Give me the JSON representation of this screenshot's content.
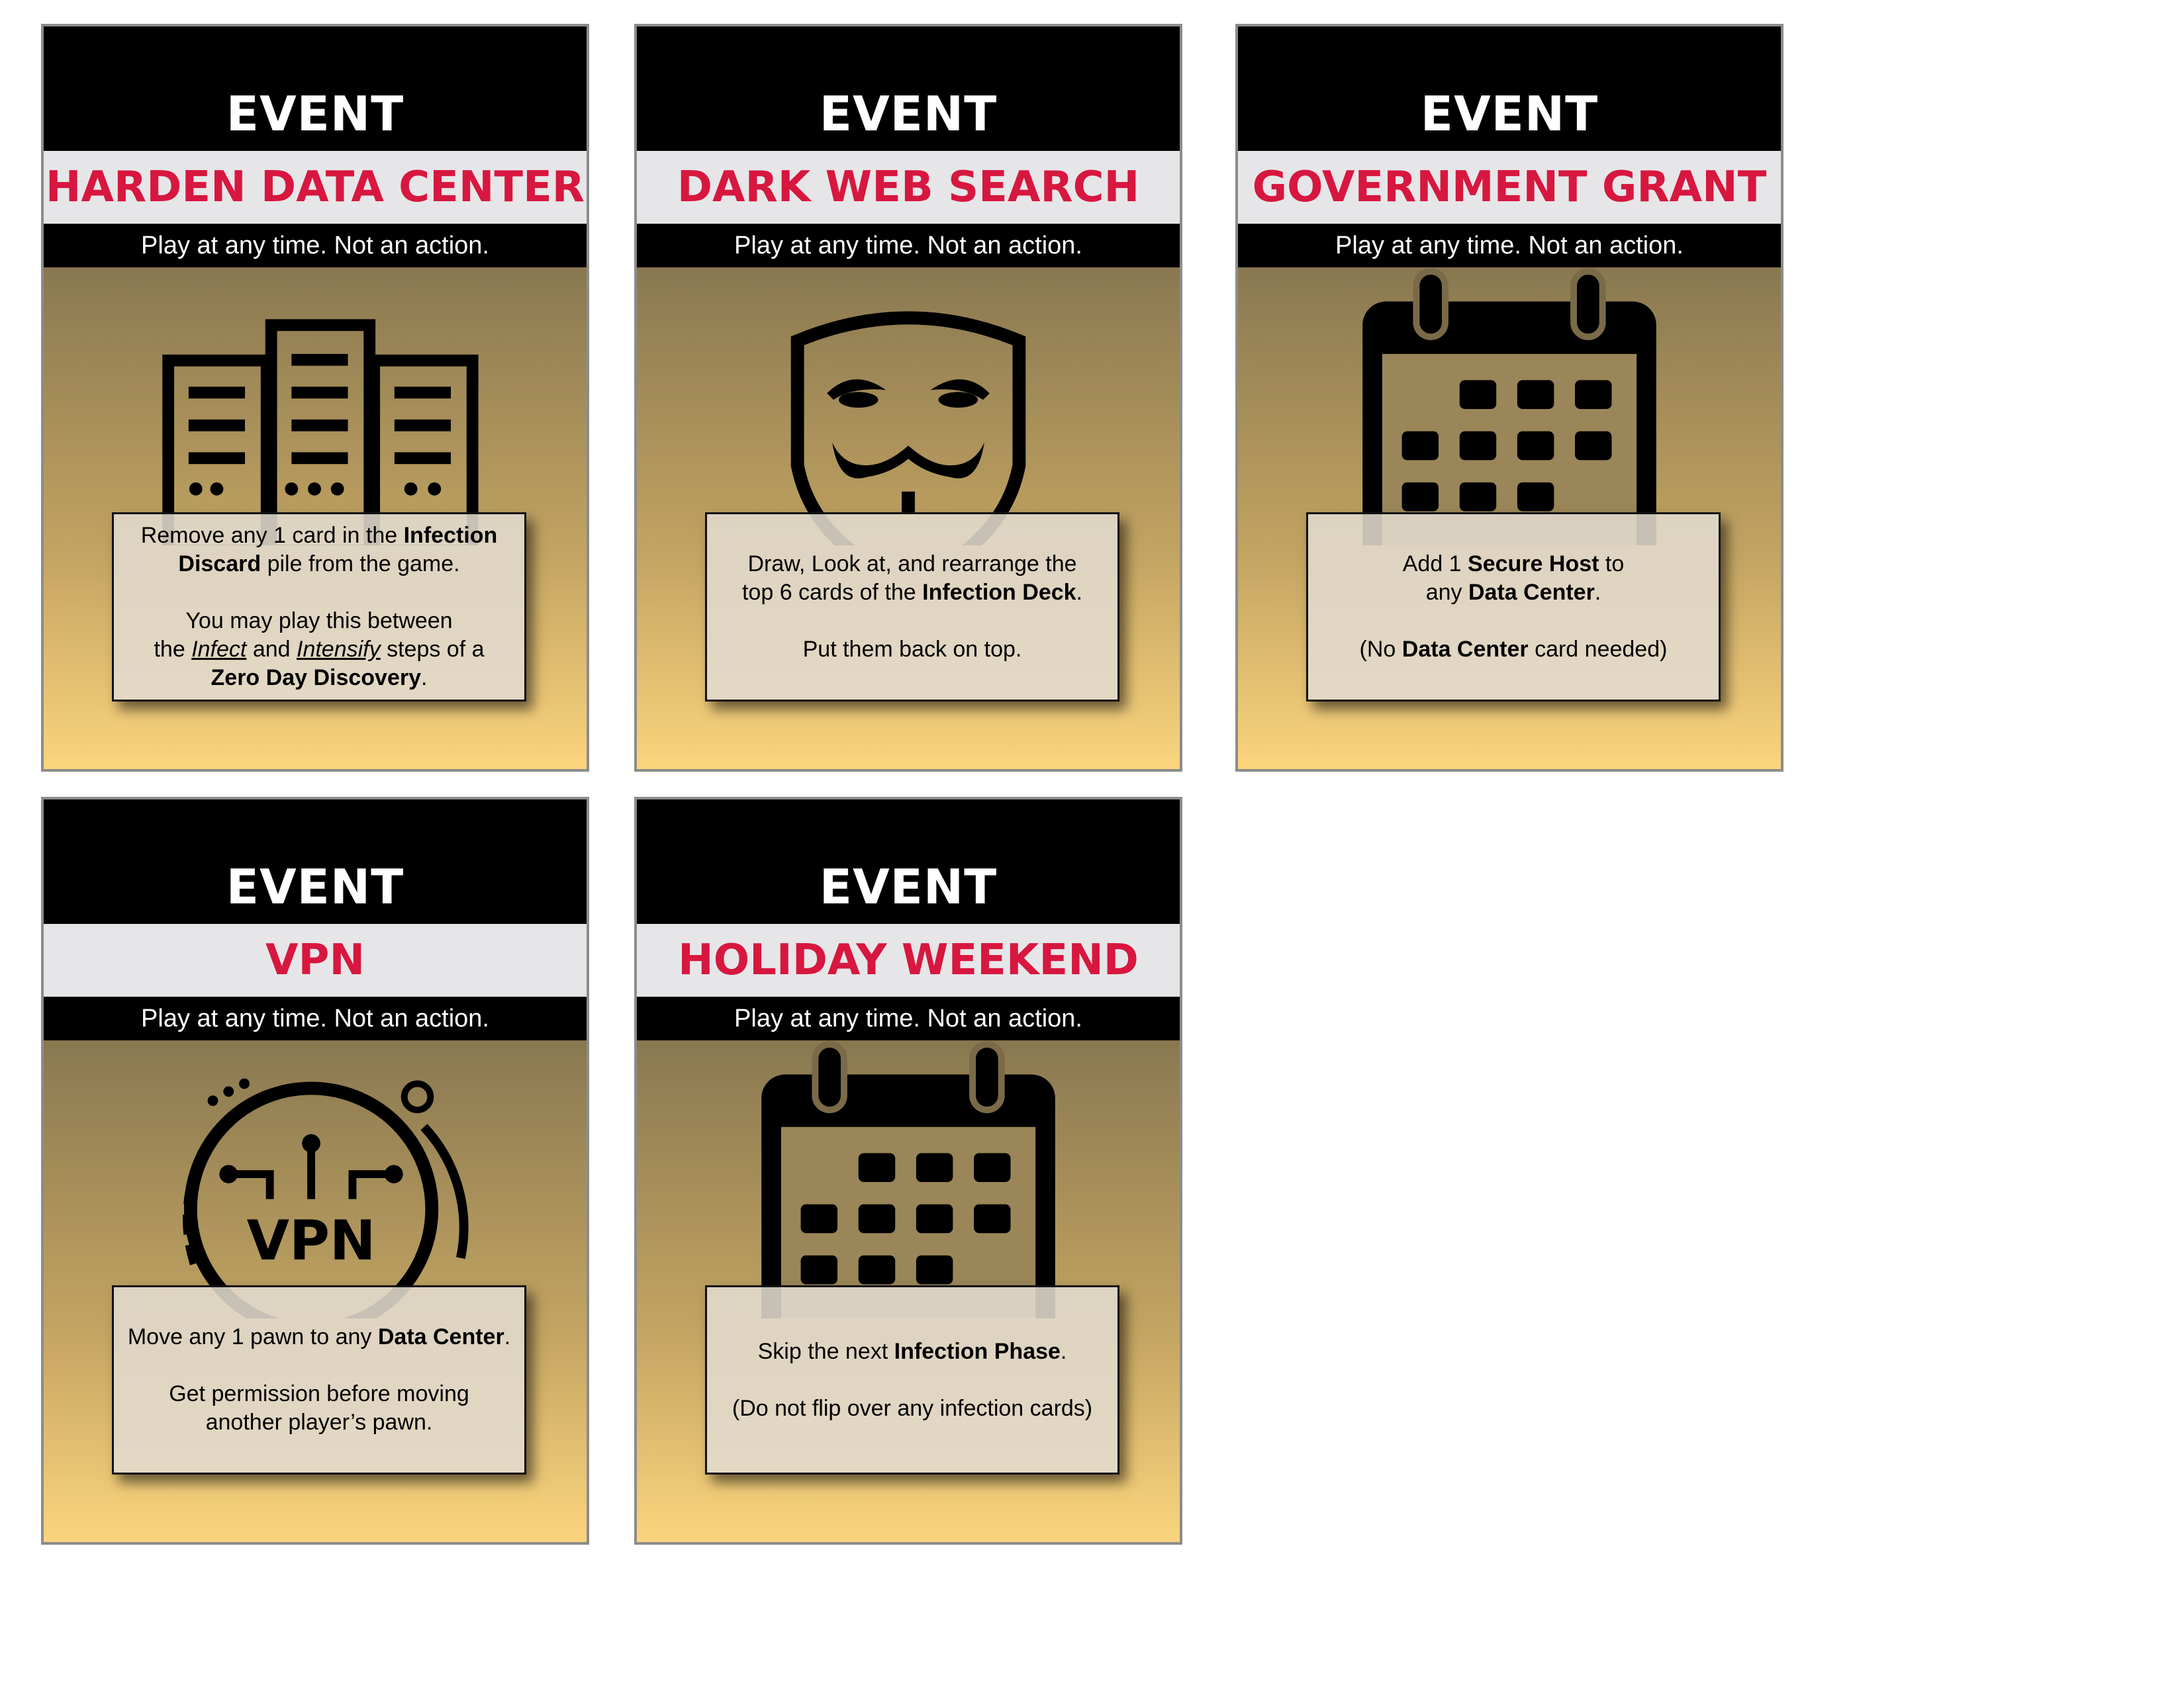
{
  "cards": [
    {
      "header": "EVENT",
      "title": "HARDEN DATA CENTER",
      "subtitle": "Play at any time. Not an action.",
      "icon": "server-rack-icon",
      "text": {
        "p1_a": "Remove any 1 card in the ",
        "p1_b": "Infection",
        "p1_c": "Discard",
        "p1_d": " pile from the game.",
        "p2_a": "You may play this between",
        "p2_b": "the ",
        "p2_c": "Infect",
        "p2_d": " and ",
        "p2_e": "Intensify",
        "p2_f": " steps of a",
        "p2_g": "Zero Day Discovery",
        "p2_h": "."
      }
    },
    {
      "header": "EVENT",
      "title": "DARK WEB SEARCH",
      "subtitle": "Play at any time. Not an action.",
      "icon": "anonymous-mask-icon",
      "text": {
        "p1_a": "Draw, Look at, and rearrange the",
        "p1_b": "top 6 cards of the ",
        "p1_c": "Infection Deck",
        "p1_d": ".",
        "p2_a": "Put them back on top."
      }
    },
    {
      "header": "EVENT",
      "title": "GOVERNMENT GRANT",
      "subtitle": "Play at any time. Not an action.",
      "icon": "calendar-icon",
      "text": {
        "p1_a": "Add 1 ",
        "p1_b": "Secure Host",
        "p1_c": " to",
        "p1_d": "any ",
        "p1_e": "Data Center",
        "p1_f": ".",
        "p2_a": "(No ",
        "p2_b": "Data Center",
        "p2_c": " card needed)"
      }
    },
    {
      "header": "EVENT",
      "title": "VPN",
      "subtitle": "Play at any time. Not an action.",
      "icon": "vpn-icon",
      "icon_label": "VPN",
      "text": {
        "p1_a": "Move any 1 pawn to any ",
        "p1_b": "Data Center",
        "p1_c": ".",
        "p2_a": "Get permission before moving",
        "p2_b": "another player’s pawn."
      }
    },
    {
      "header": "EVENT",
      "title": "HOLIDAY WEEKEND",
      "subtitle": "Play at any time. Not an action.",
      "icon": "calendar-icon",
      "text": {
        "p1_a": "Skip the next ",
        "p1_b": "Infection Phase",
        "p1_c": ".",
        "p2_a": "(Do not flip over any infection cards)"
      }
    }
  ],
  "colors": {
    "title_red": "#d7173f",
    "header_black": "#000000",
    "title_band": "#e6e6e8",
    "gradient_top": "#4a4136",
    "gradient_bottom": "#fbd47d"
  }
}
